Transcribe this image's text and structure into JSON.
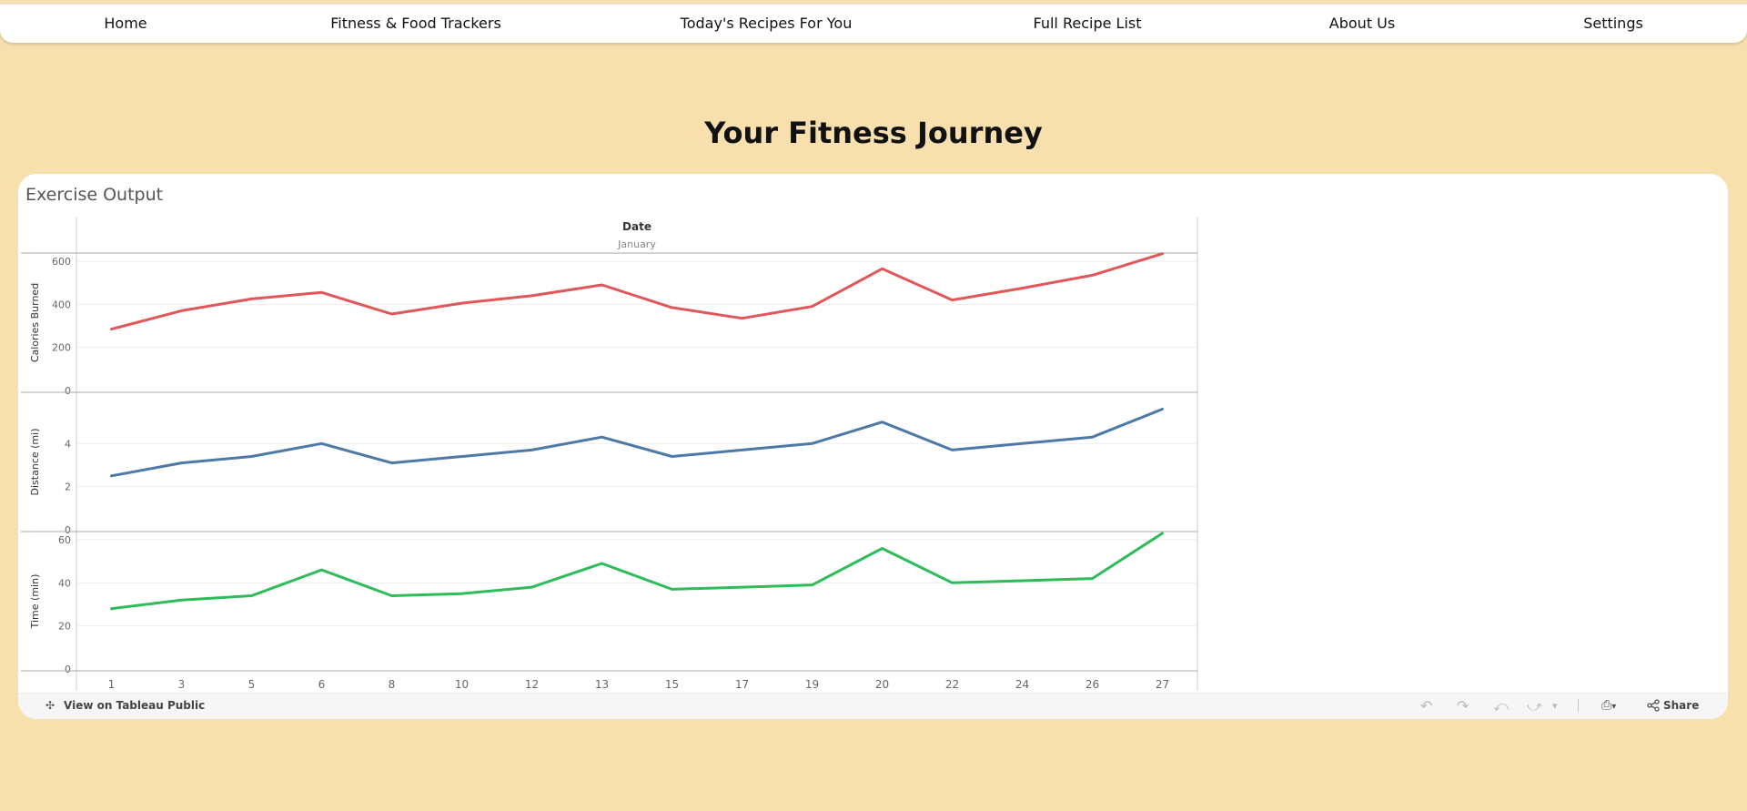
{
  "nav": {
    "items": [
      {
        "label": "Home"
      },
      {
        "label": "Fitness & Food Trackers"
      },
      {
        "label": "Today's Recipes For You"
      },
      {
        "label": "Full Recipe List"
      },
      {
        "label": "About Us"
      },
      {
        "label": "Settings"
      }
    ]
  },
  "page_title": "Your Fitness Journey",
  "dashboard": {
    "title": "Exercise Output",
    "footer": {
      "view_link": "View on Tableau Public",
      "share_label": "Share"
    }
  },
  "chart_data": {
    "type": "line",
    "column_header": "Date",
    "column_sub_header": "January",
    "x": [
      1,
      3,
      5,
      6,
      8,
      10,
      12,
      13,
      15,
      17,
      19,
      20,
      22,
      24,
      26,
      27
    ],
    "panels": [
      {
        "ylabel": "Calories Burned",
        "color": "#e15759",
        "ylim": [
          0,
          600
        ],
        "yticks": [
          0,
          200,
          400,
          600
        ],
        "values": [
          285,
          370,
          425,
          455,
          355,
          405,
          440,
          490,
          385,
          335,
          390,
          565,
          420,
          475,
          535,
          635
        ]
      },
      {
        "ylabel": "Distance (mi)",
        "color": "#4e79a7",
        "ylim": [
          0,
          6
        ],
        "yticks": [
          0,
          2,
          4
        ],
        "values": [
          2.5,
          3.1,
          3.4,
          4.0,
          3.1,
          3.4,
          3.7,
          4.3,
          3.4,
          3.7,
          4.0,
          5.0,
          3.7,
          4.0,
          4.3,
          5.6
        ]
      },
      {
        "ylabel": "Time (min)",
        "color": "#2ebc5a",
        "ylim": [
          0,
          60
        ],
        "yticks": [
          0,
          20,
          40,
          60
        ],
        "values": [
          28,
          32,
          34,
          46,
          34,
          35,
          38,
          49,
          37,
          38,
          39,
          56,
          40,
          41,
          42,
          63
        ]
      }
    ]
  }
}
